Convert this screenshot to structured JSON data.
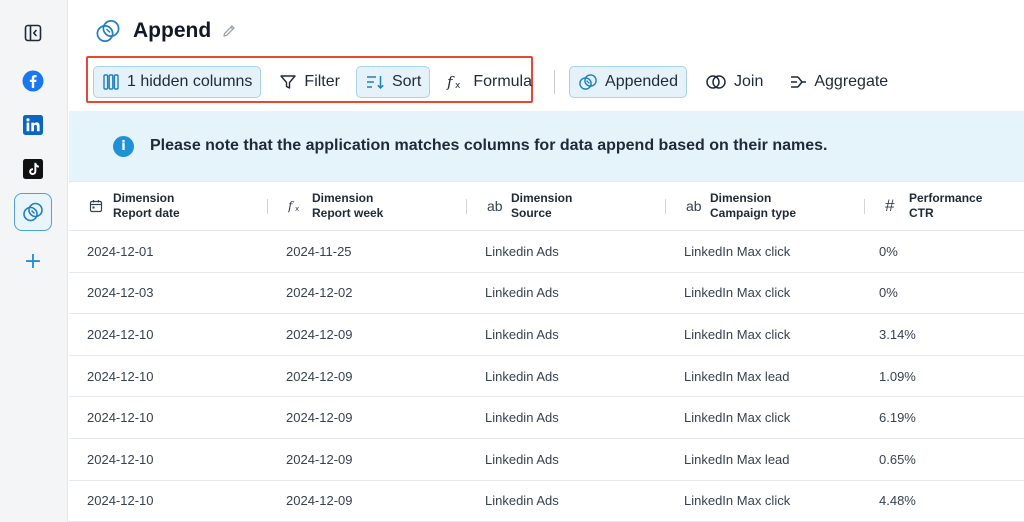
{
  "page": {
    "title": "Append"
  },
  "sidebar": {
    "items": [
      {
        "name": "collapse-sidebar",
        "icon": "panel-collapse-icon"
      },
      {
        "name": "facebook",
        "icon": "facebook-icon"
      },
      {
        "name": "linkedin",
        "icon": "linkedin-icon"
      },
      {
        "name": "tiktok",
        "icon": "tiktok-icon"
      },
      {
        "name": "append",
        "icon": "append-icon",
        "active": true
      },
      {
        "name": "add",
        "icon": "plus-icon"
      }
    ],
    "add_label": "+"
  },
  "toolbar": {
    "hidden_columns_label": "1 hidden columns",
    "filter_label": "Filter",
    "sort_label": "Sort",
    "formula_label": "Formula",
    "appended_label": "Appended",
    "join_label": "Join",
    "aggregate_label": "Aggregate"
  },
  "notice": {
    "text": "Please note that the application matches columns for data append based on their names.",
    "icon_glyph": "i"
  },
  "table": {
    "columns": [
      {
        "icon": "calendar-icon",
        "line1": "Dimension",
        "line2": "Report date"
      },
      {
        "icon": "formula-icon",
        "line1": "Dimension",
        "line2": "Report week"
      },
      {
        "icon": "text-type-icon",
        "icon_text": "ab",
        "line1": "Dimension",
        "line2": "Source"
      },
      {
        "icon": "text-type-icon",
        "icon_text": "ab",
        "line1": "Dimension",
        "line2": "Campaign type"
      },
      {
        "icon": "number-type-icon",
        "icon_text": "#",
        "line1": "Performance",
        "line2": "CTR"
      }
    ],
    "rows": [
      [
        "2024-12-01",
        "2024-11-25",
        "Linkedin Ads",
        "LinkedIn Max click",
        "0%"
      ],
      [
        "2024-12-03",
        "2024-12-02",
        "Linkedin Ads",
        "LinkedIn Max click",
        "0%"
      ],
      [
        "2024-12-10",
        "2024-12-09",
        "Linkedin Ads",
        "LinkedIn Max click",
        "3.14%"
      ],
      [
        "2024-12-10",
        "2024-12-09",
        "Linkedin Ads",
        "LinkedIn Max lead",
        "1.09%"
      ],
      [
        "2024-12-10",
        "2024-12-09",
        "Linkedin Ads",
        "LinkedIn Max click",
        "6.19%"
      ],
      [
        "2024-12-10",
        "2024-12-09",
        "Linkedin Ads",
        "LinkedIn Max lead",
        "0.65%"
      ],
      [
        "2024-12-10",
        "2024-12-09",
        "Linkedin Ads",
        "LinkedIn Max click",
        "4.48%"
      ]
    ]
  },
  "colors": {
    "accent": "#1f91d6",
    "highlight": "#e8492e",
    "notice_bg": "#e5f4fb"
  }
}
